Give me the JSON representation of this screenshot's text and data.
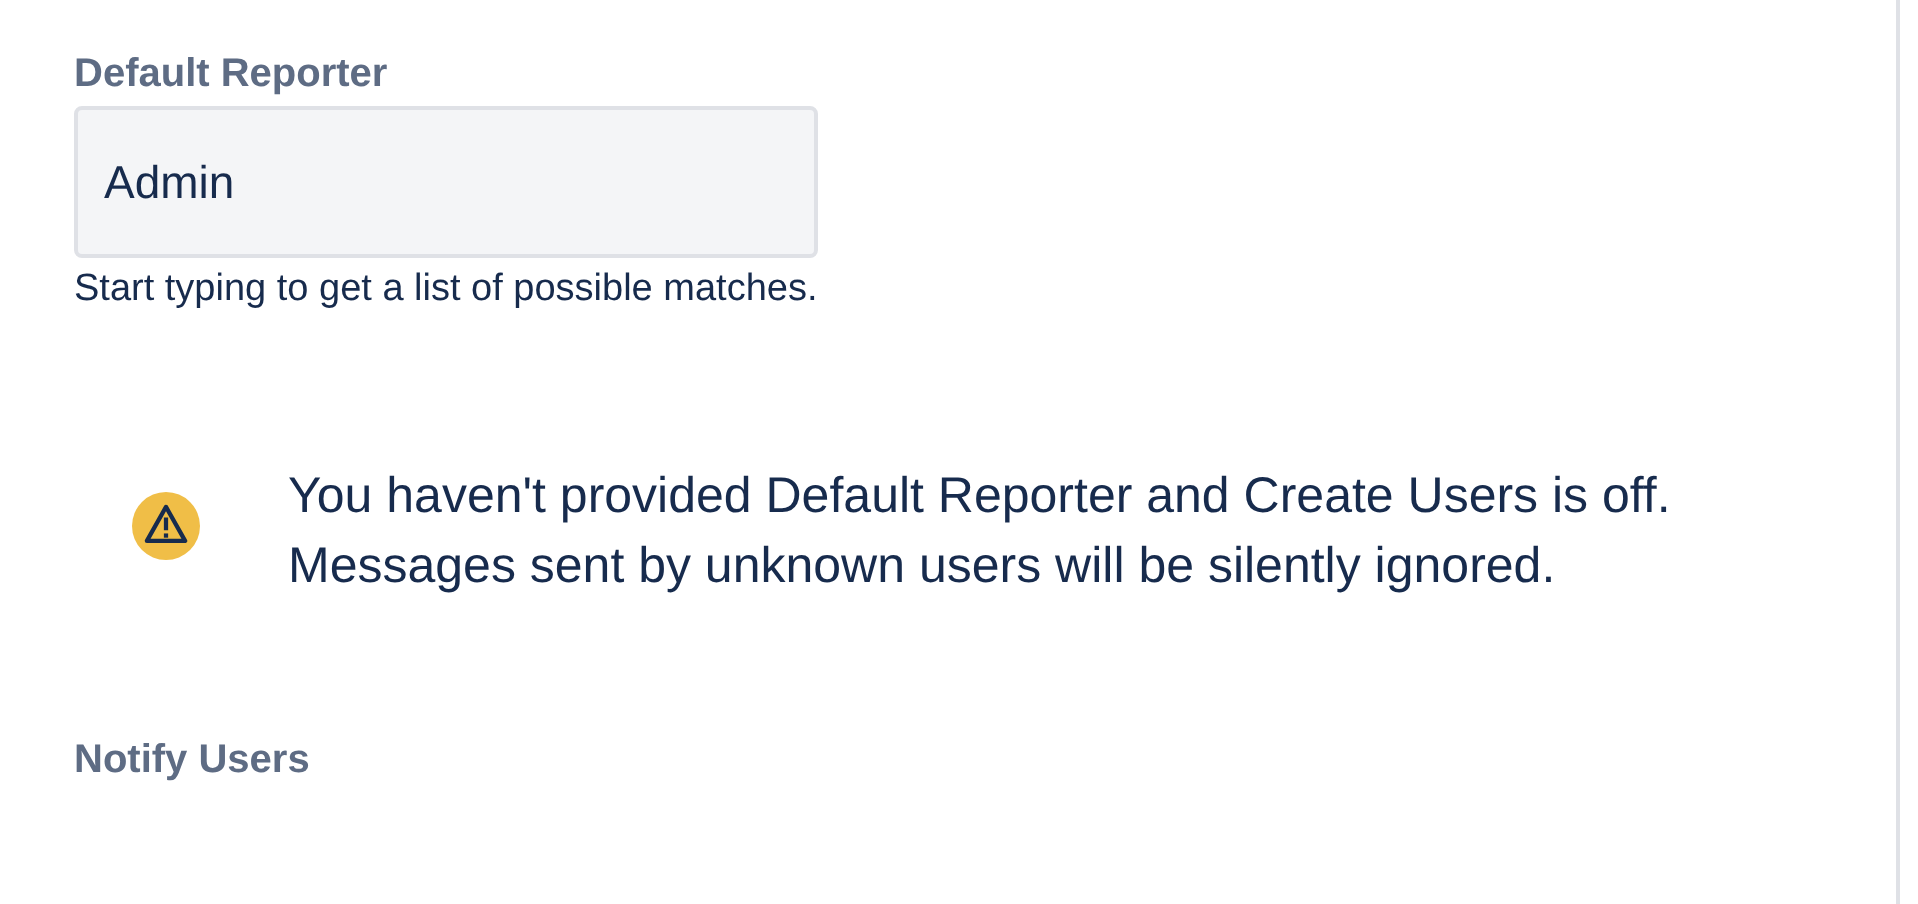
{
  "default_reporter": {
    "label": "Default Reporter",
    "value": "Admin",
    "help": "Start typing to get a list of possible matches."
  },
  "warning": {
    "kind": "warning",
    "message": "You haven't provided Default Reporter and Create Users is off. Messages sent by unknown users will be silently ignored."
  },
  "notify_users": {
    "label": "Notify Users"
  }
}
